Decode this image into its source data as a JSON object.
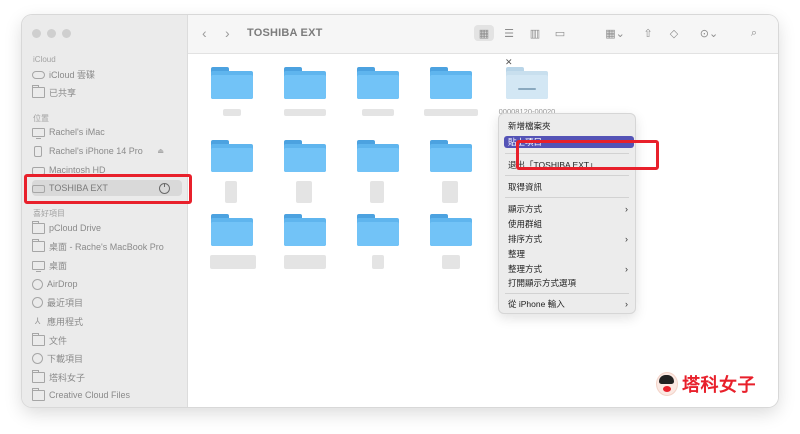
{
  "window": {
    "title": "TOSHIBA EXT"
  },
  "sidebar": {
    "sections": [
      {
        "label": "iCloud",
        "items": [
          {
            "label": "iCloud 雲碟",
            "icon": "cloud-icon"
          },
          {
            "label": "已共享",
            "icon": "shared-folder-icon"
          }
        ]
      },
      {
        "label": "位置",
        "items": [
          {
            "label": "Rachel's iMac",
            "icon": "computer-icon"
          },
          {
            "label": "Rachel's iPhone 14 Pro",
            "icon": "iphone-icon"
          },
          {
            "label": "Macintosh HD",
            "icon": "disk-icon"
          },
          {
            "label": "TOSHIBA EXT",
            "icon": "external-disk-icon",
            "selected": true
          }
        ]
      },
      {
        "label": "喜好項目",
        "items": [
          {
            "label": "pCloud Drive",
            "icon": "folder-icon"
          },
          {
            "label": "桌面 - Rache's MacBook Pro",
            "icon": "folder-icon"
          },
          {
            "label": "桌面",
            "icon": "desktop-icon"
          },
          {
            "label": "AirDrop",
            "icon": "airdrop-icon"
          },
          {
            "label": "最近項目",
            "icon": "clock-icon"
          },
          {
            "label": "應用程式",
            "icon": "applications-icon"
          },
          {
            "label": "文件",
            "icon": "document-icon"
          },
          {
            "label": "下載項目",
            "icon": "download-icon"
          },
          {
            "label": "塔科女子",
            "icon": "folder-icon"
          },
          {
            "label": "Creative Cloud Files",
            "icon": "folder-icon"
          }
        ]
      }
    ]
  },
  "toolbar": {
    "back": "‹",
    "forward": "›",
    "icons": [
      "icon-view-icon",
      "list-view-icon",
      "column-view-icon",
      "gallery-view-icon",
      "group-icon",
      "share-icon",
      "tag-icon",
      "more-icon",
      "search-icon"
    ]
  },
  "files": {
    "dragged_folder_name": "00008120-00020\n4C21EE8401E"
  },
  "context_menu": {
    "items": [
      {
        "label": "新增檔案夾",
        "submenu": false
      },
      {
        "label": "貼上項目",
        "submenu": false,
        "highlighted": true
      },
      {
        "label": "退出「TOSHIBA EXT」",
        "submenu": false
      },
      {
        "label": "取得資訊",
        "submenu": false
      },
      {
        "label": "顯示方式",
        "submenu": true
      },
      {
        "label": "使用群組",
        "submenu": false
      },
      {
        "label": "排序方式",
        "submenu": true
      },
      {
        "label": "整理",
        "submenu": false
      },
      {
        "label": "整理方式",
        "submenu": true
      },
      {
        "label": "打開顯示方式選項",
        "submenu": false
      },
      {
        "label": "從 iPhone 輸入",
        "submenu": true
      }
    ]
  },
  "watermark": {
    "text": "塔科女子"
  },
  "colors": {
    "highlight": "#e8202b",
    "menu_selection": "#5453b6",
    "folder": "#5fb5ee"
  }
}
